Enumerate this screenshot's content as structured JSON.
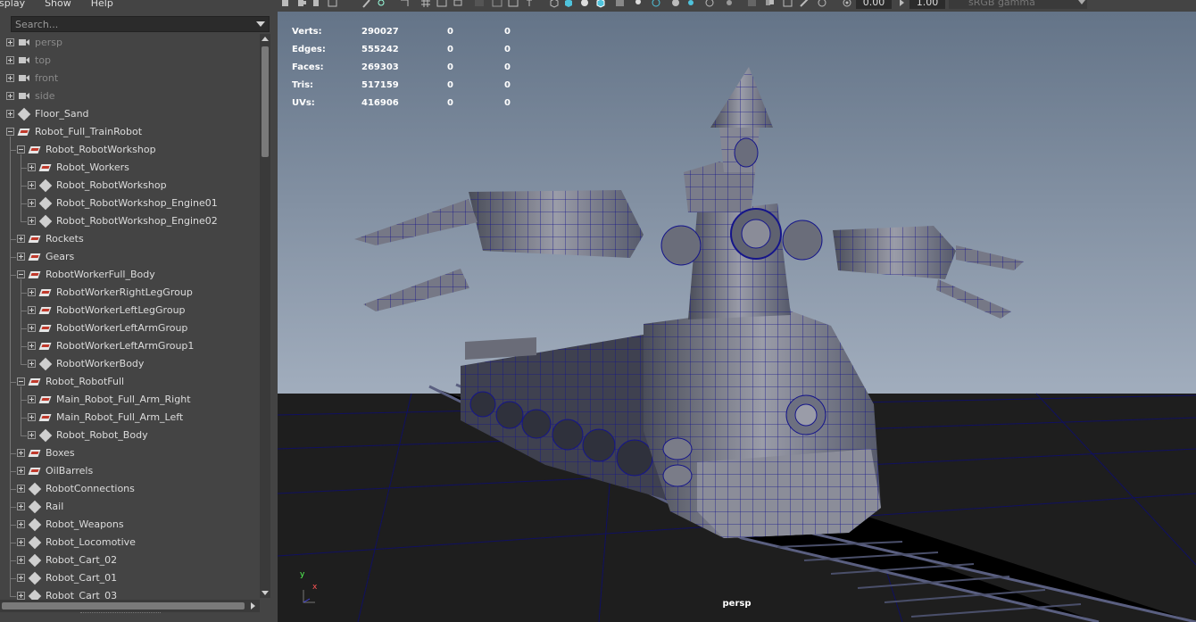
{
  "menu": [
    "isplay",
    "Show",
    "Help"
  ],
  "outliner": {
    "search_placeholder": "Search...",
    "items": [
      {
        "label": "persp",
        "icon": "camera-icon",
        "depth": 0,
        "expander": "plus",
        "dim": true
      },
      {
        "label": "top",
        "icon": "camera-icon",
        "depth": 0,
        "expander": "plus",
        "dim": true
      },
      {
        "label": "front",
        "icon": "camera-icon",
        "depth": 0,
        "expander": "plus",
        "dim": true
      },
      {
        "label": "side",
        "icon": "camera-icon",
        "depth": 0,
        "expander": "plus",
        "dim": true
      },
      {
        "label": "Floor_Sand",
        "icon": "group-icon",
        "depth": 0,
        "expander": "plus"
      },
      {
        "label": "Robot_Full_TrainRobot",
        "icon": "mesh-icon",
        "depth": 0,
        "expander": "minus"
      },
      {
        "label": "Robot_RobotWorkshop",
        "icon": "mesh-icon",
        "depth": 1,
        "expander": "minus"
      },
      {
        "label": "Robot_Workers",
        "icon": "mesh-icon",
        "depth": 2,
        "expander": "plus"
      },
      {
        "label": "Robot_RobotWorkshop",
        "icon": "group-icon",
        "depth": 2,
        "expander": "plus"
      },
      {
        "label": "Robot_RobotWorkshop_Engine01",
        "icon": "group-icon",
        "depth": 2,
        "expander": "plus"
      },
      {
        "label": "Robot_RobotWorkshop_Engine02",
        "icon": "group-icon",
        "depth": 2,
        "expander": "plus"
      },
      {
        "label": "Rockets",
        "icon": "mesh-icon",
        "depth": 1,
        "expander": "plus"
      },
      {
        "label": "Gears",
        "icon": "mesh-icon",
        "depth": 1,
        "expander": "plus"
      },
      {
        "label": "RobotWorkerFull_Body",
        "icon": "mesh-icon",
        "depth": 1,
        "expander": "minus"
      },
      {
        "label": "RobotWorkerRightLegGroup",
        "icon": "mesh-icon",
        "depth": 2,
        "expander": "plus"
      },
      {
        "label": "RobotWorkerLeftLegGroup",
        "icon": "mesh-icon",
        "depth": 2,
        "expander": "plus"
      },
      {
        "label": "RobotWorkerLeftArmGroup",
        "icon": "mesh-icon",
        "depth": 2,
        "expander": "plus"
      },
      {
        "label": "RobotWorkerLeftArmGroup1",
        "icon": "mesh-icon",
        "depth": 2,
        "expander": "plus"
      },
      {
        "label": "RobotWorkerBody",
        "icon": "group-icon",
        "depth": 2,
        "expander": "plus"
      },
      {
        "label": "Robot_RobotFull",
        "icon": "mesh-icon",
        "depth": 1,
        "expander": "minus"
      },
      {
        "label": "Main_Robot_Full_Arm_Right",
        "icon": "mesh-icon",
        "depth": 2,
        "expander": "plus"
      },
      {
        "label": "Main_Robot_Full_Arm_Left",
        "icon": "mesh-icon",
        "depth": 2,
        "expander": "plus"
      },
      {
        "label": "Robot_Robot_Body",
        "icon": "group-icon",
        "depth": 2,
        "expander": "plus"
      },
      {
        "label": "Boxes",
        "icon": "mesh-icon",
        "depth": 1,
        "expander": "plus"
      },
      {
        "label": "OilBarrels",
        "icon": "mesh-icon",
        "depth": 1,
        "expander": "plus"
      },
      {
        "label": "RobotConnections",
        "icon": "group-icon",
        "depth": 1,
        "expander": "plus"
      },
      {
        "label": "Rail",
        "icon": "group-icon",
        "depth": 1,
        "expander": "plus"
      },
      {
        "label": "Robot_Weapons",
        "icon": "group-icon",
        "depth": 1,
        "expander": "plus"
      },
      {
        "label": "Robot_Locomotive",
        "icon": "group-icon",
        "depth": 1,
        "expander": "plus"
      },
      {
        "label": "Robot_Cart_02",
        "icon": "group-icon",
        "depth": 1,
        "expander": "plus"
      },
      {
        "label": "Robot_Cart_01",
        "icon": "group-icon",
        "depth": 1,
        "expander": "plus"
      },
      {
        "label": "Robot_Cart_03",
        "icon": "group-icon",
        "depth": 1,
        "expander": "plus"
      }
    ]
  },
  "viewport": {
    "toolbar": {
      "exposure": "0.00",
      "gamma": "1.00",
      "color_space": "sRGB gamma"
    },
    "hud": [
      {
        "label": "Verts:",
        "v1": "290027",
        "v2": "0",
        "v3": "0"
      },
      {
        "label": "Edges:",
        "v1": "555242",
        "v2": "0",
        "v3": "0"
      },
      {
        "label": "Faces:",
        "v1": "269303",
        "v2": "0",
        "v3": "0"
      },
      {
        "label": "Tris:",
        "v1": "517159",
        "v2": "0",
        "v3": "0"
      },
      {
        "label": "UVs:",
        "v1": "416906",
        "v2": "0",
        "v3": "0"
      }
    ],
    "camera_label": "persp",
    "axis": {
      "y": "y",
      "x": "x"
    }
  },
  "colors": {
    "panel": "#444444",
    "field": "#2b2b2b",
    "wire": "#1a1a9c",
    "sky_top": "#6a7a90",
    "sky_bottom": "#9aa7b8",
    "ground": "#1c1c1c"
  }
}
